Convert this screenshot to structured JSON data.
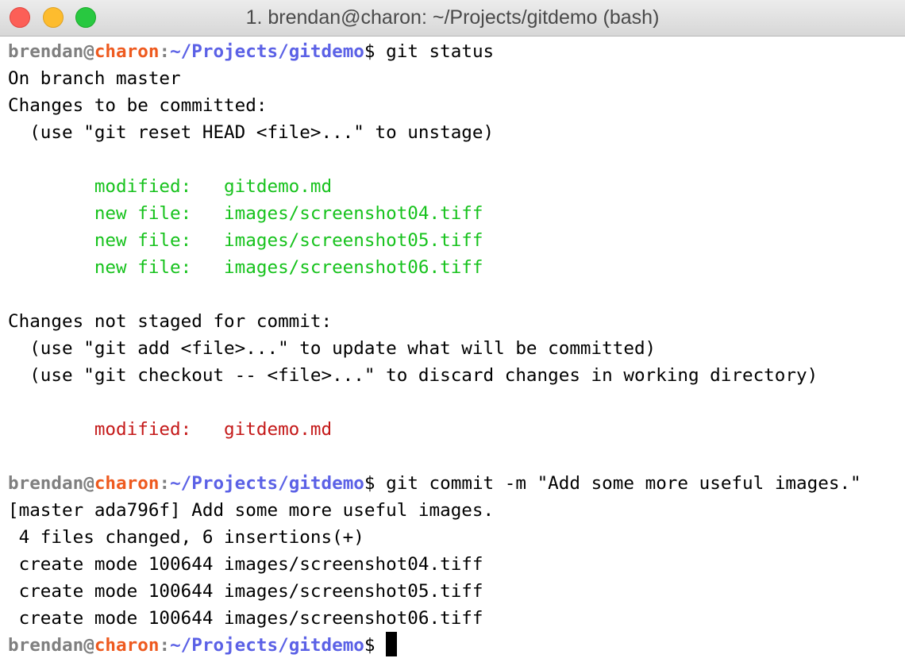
{
  "window": {
    "title": "1. brendan@charon: ~/Projects/gitdemo (bash)"
  },
  "prompt": {
    "user": "brendan",
    "at": "@",
    "host": "charon",
    "colon": ":",
    "path": "~/Projects/gitdemo",
    "symbol": "$"
  },
  "colors": {
    "staged": "#16c21c",
    "unstaged": "#c41818",
    "host": "#ee5a1f",
    "path": "#5b61e6"
  },
  "terminal": {
    "cmd1": " git status",
    "status": {
      "branch": "On branch master",
      "staged_header": "Changes to be committed:",
      "staged_hint": "  (use \"git reset HEAD <file>...\" to unstage)",
      "staged_files": [
        "        modified:   gitdemo.md",
        "        new file:   images/screenshot04.tiff",
        "        new file:   images/screenshot05.tiff",
        "        new file:   images/screenshot06.tiff"
      ],
      "unstaged_header": "Changes not staged for commit:",
      "unstaged_hint_1": "  (use \"git add <file>...\" to update what will be committed)",
      "unstaged_hint_2": "  (use \"git checkout -- <file>...\" to discard changes in working directory)",
      "unstaged_files": [
        "        modified:   gitdemo.md"
      ]
    },
    "cmd2": " git commit -m \"Add some more useful images.\"",
    "commit_output": [
      "[master ada796f] Add some more useful images.",
      " 4 files changed, 6 insertions(+)",
      " create mode 100644 images/screenshot04.tiff",
      " create mode 100644 images/screenshot05.tiff",
      " create mode 100644 images/screenshot06.tiff"
    ],
    "cmd3": " "
  }
}
